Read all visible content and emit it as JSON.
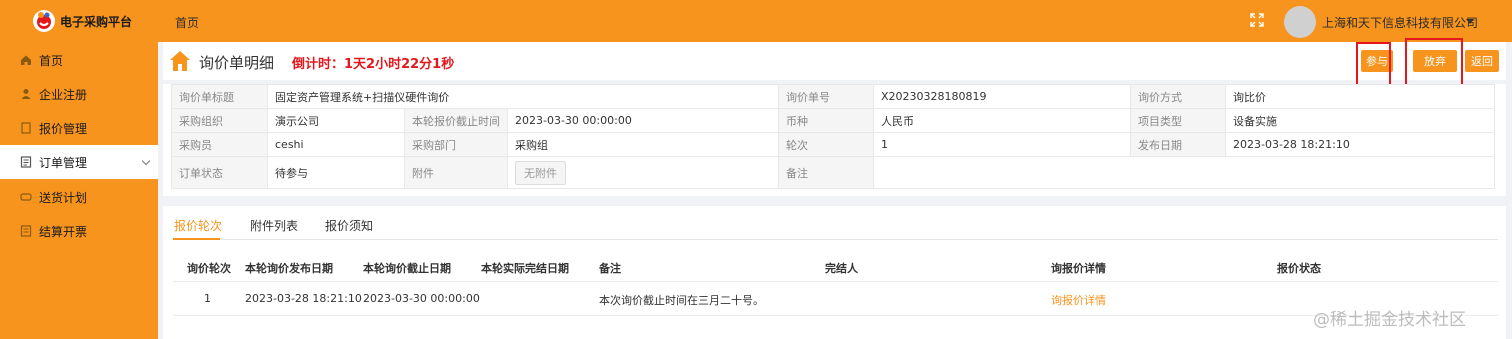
{
  "app": {
    "title": "电子采购平台",
    "top_home": "首页",
    "company": "上海和天下信息科技有限公司"
  },
  "sidebar": {
    "items": [
      {
        "label": "首页",
        "icon": "home-icon"
      },
      {
        "label": "企业注册",
        "icon": "user-icon"
      },
      {
        "label": "报价管理",
        "icon": "document-icon"
      },
      {
        "label": "订单管理",
        "icon": "list-icon",
        "active": true
      },
      {
        "label": "送货计划",
        "icon": "truck-icon"
      },
      {
        "label": "结算开票",
        "icon": "invoice-icon"
      }
    ]
  },
  "header": {
    "title": "询价单明细",
    "countdown": "倒计时：1天2小时22分1秒",
    "join_label": "参与",
    "abandon_label": "放弃",
    "back_label": "返回"
  },
  "info": {
    "title_label": "询价单标题",
    "title_value": "固定资产管理系统+扫描仪硬件询价",
    "no_label": "询价单号",
    "no_value": "X20230328180819",
    "method_label": "询价方式",
    "method_value": "询比价",
    "org_label": "采购组织",
    "org_value": "演示公司",
    "deadline_label": "本轮报价截止时间",
    "deadline_value": "2023-03-30 00:00:00",
    "currency_label": "币种",
    "currency_value": "人民币",
    "project_label": "项目类型",
    "project_value": "设备实施",
    "buyer_label": "采购员",
    "buyer_value": "ceshi",
    "dept_label": "采购部门",
    "dept_value": "采购组",
    "round_label": "轮次",
    "round_value": "1",
    "publish_label": "发布日期",
    "publish_value": "2023-03-28 18:21:10",
    "status_label": "订单状态",
    "status_value": "待参与",
    "attach_label": "附件",
    "attach_value": "无附件",
    "remark_label": "备注",
    "remark_value": ""
  },
  "tabs": [
    "报价轮次",
    "附件列表",
    "报价须知"
  ],
  "rounds": {
    "headers": [
      "询价轮次",
      "本轮询价发布日期",
      "本轮询价截止日期",
      "本轮实际完结日期",
      "备注",
      "完结人",
      "询报价详情",
      "报价状态"
    ],
    "rows": [
      [
        "1",
        "2023-03-28 18:21:10",
        "2023-03-30 00:00:00",
        "",
        "本次询价截止时间在三月二十号。",
        "",
        "询报价详情",
        ""
      ]
    ]
  },
  "watermark": "@稀土掘金技术社区",
  "colors": {
    "accent": "#f7941d",
    "danger": "#e4181c"
  }
}
